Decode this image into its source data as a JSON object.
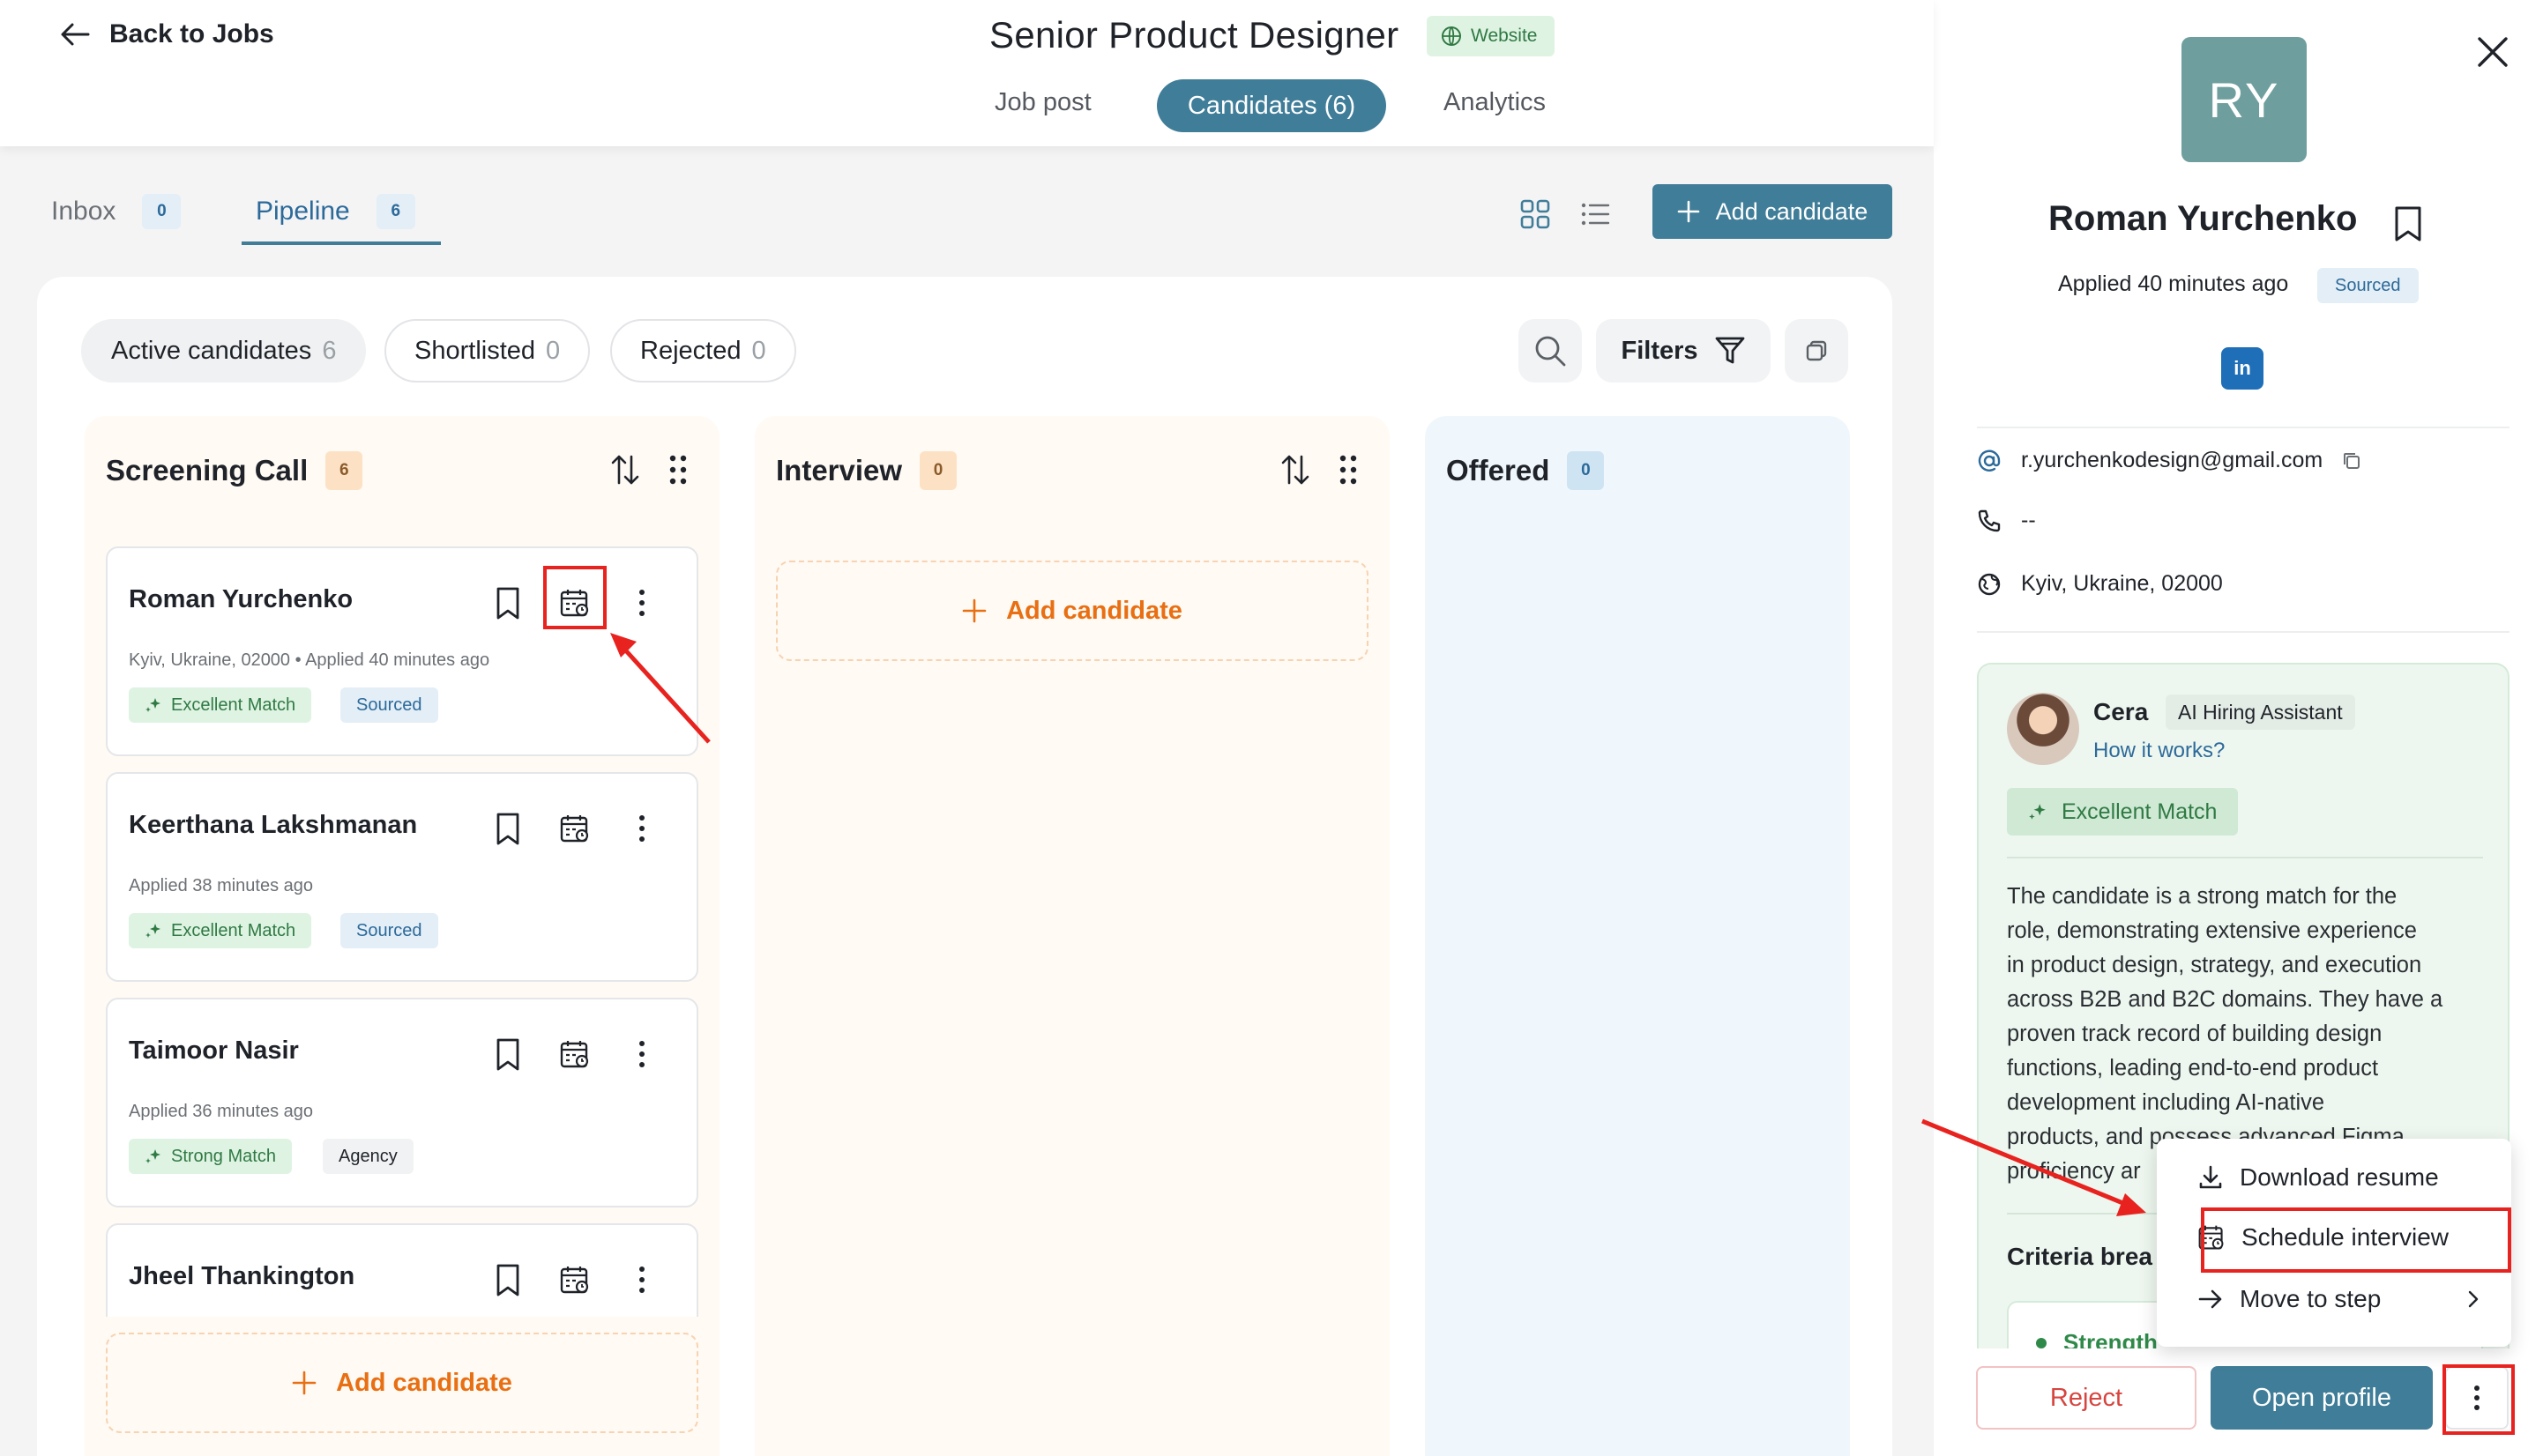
{
  "header": {
    "back_label": "Back to Jobs",
    "job_title": "Senior Product Designer",
    "website_badge": "Website",
    "tabs": {
      "job_post": "Job post",
      "candidates": "Candidates (6)",
      "analytics": "Analytics"
    }
  },
  "subtabs": {
    "inbox": {
      "label": "Inbox",
      "count": "0"
    },
    "pipeline": {
      "label": "Pipeline",
      "count": "6"
    }
  },
  "add_candidate_button": "Add candidate",
  "filters": {
    "active": {
      "label": "Active candidates",
      "count": "6"
    },
    "shortlisted": {
      "label": "Shortlisted",
      "count": "0"
    },
    "rejected": {
      "label": "Rejected",
      "count": "0"
    },
    "filters_label": "Filters"
  },
  "columns": {
    "screening": {
      "title": "Screening Call",
      "count": "6",
      "cards": [
        {
          "name": "Roman Yurchenko",
          "meta": "Kyiv, Ukraine, 02000 • Applied 40 minutes ago",
          "match": "Excellent Match",
          "tag": "Sourced"
        },
        {
          "name": "Keerthana Lakshmanan",
          "meta": "Applied 38 minutes ago",
          "match": "Excellent Match",
          "tag": "Sourced"
        },
        {
          "name": "Taimoor Nasir",
          "meta": "Applied 36 minutes ago",
          "match": "Strong Match",
          "tag": "Agency"
        },
        {
          "name": "Jheel Thankington"
        }
      ],
      "add_label": "Add candidate"
    },
    "interview": {
      "title": "Interview",
      "count": "0",
      "add_label": "Add candidate"
    },
    "offered": {
      "title": "Offered",
      "count": "0"
    }
  },
  "panel": {
    "initials": "RY",
    "name": "Roman Yurchenko",
    "applied": "Applied 40 minutes ago",
    "source": "Sourced",
    "linkedin": "in",
    "email": "r.yurchenkodesign@gmail.com",
    "phone": "--",
    "location": "Kyiv, Ukraine, 02000",
    "ai": {
      "name": "Cera",
      "role": "AI Hiring Assistant",
      "link": "How it works?",
      "match": "Excellent Match",
      "summary_lines": [
        "The candidate is a strong match for the",
        "role, demonstrating extensive experience",
        "in product design, strategy, and execution",
        "across B2B and B2C domains. They have a",
        "proven track record of building design",
        "functions, leading end-to-end product",
        "development including AI-native",
        "products, and possess advanced Figma",
        "proficiency ar"
      ],
      "criteria": "Criteria brea",
      "strength": "Strength"
    },
    "menu": {
      "download": "Download resume",
      "schedule": "Schedule interview",
      "move": "Move to step"
    },
    "reject": "Reject",
    "open_profile": "Open profile"
  },
  "colors": {
    "primary": "#3f7d98",
    "accent_orange": "#e86f12",
    "highlight_red": "#e8231f",
    "match_green": "#2f7a43"
  }
}
